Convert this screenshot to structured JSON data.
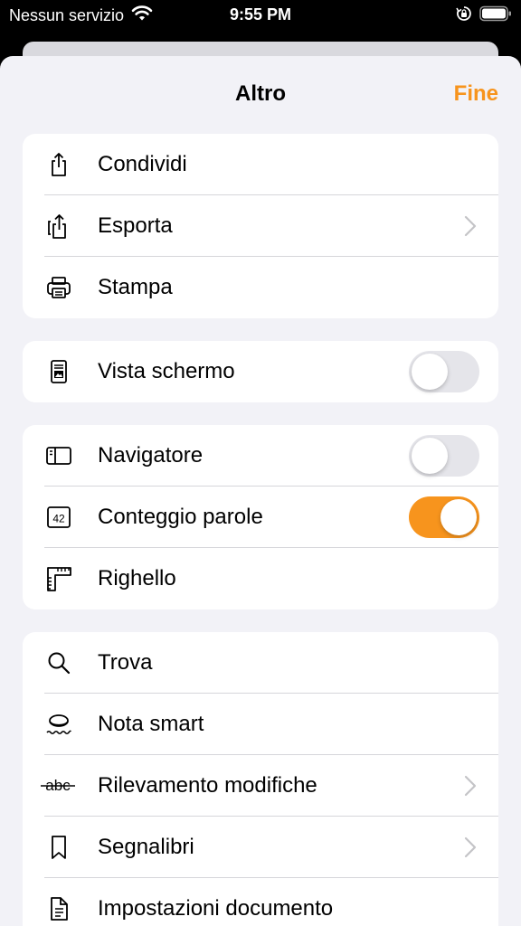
{
  "status": {
    "carrier": "Nessun servizio",
    "time": "9:55 PM"
  },
  "header": {
    "title": "Altro",
    "done_label": "Fine"
  },
  "colors": {
    "accent": "#f7941d",
    "group_background": "#ffffff",
    "sheet_background": "#f2f2f7"
  },
  "groups": {
    "share": {
      "share_label": "Condividi",
      "export_label": "Esporta",
      "print_label": "Stampa"
    },
    "view": {
      "screen_view_label": "Vista schermo",
      "screen_view_on": false
    },
    "tools": {
      "navigator_label": "Navigatore",
      "navigator_on": false,
      "word_count_label": "Conteggio parole",
      "word_count_on": true,
      "word_count_icon_text": "42",
      "ruler_label": "Righello"
    },
    "document": {
      "find_label": "Trova",
      "smart_annotation_label": "Nota smart",
      "track_changes_label": "Rilevamento modifiche",
      "track_changes_icon_text": "abc",
      "bookmarks_label": "Segnalibri",
      "document_settings_label": "Impostazioni documento"
    }
  }
}
